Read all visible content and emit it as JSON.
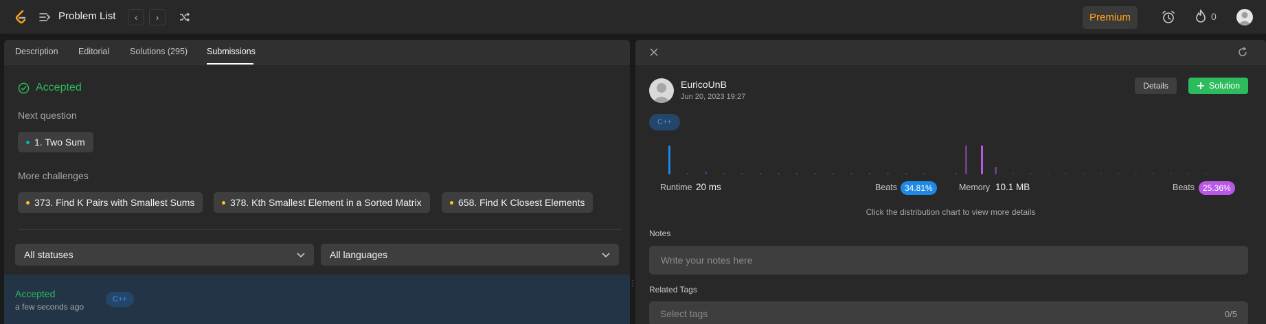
{
  "header": {
    "title": "Problem List",
    "premium_label": "Premium",
    "streak_count": "0"
  },
  "left": {
    "tabs": [
      {
        "label": "Description"
      },
      {
        "label": "Editorial"
      },
      {
        "label": "Solutions (295)"
      },
      {
        "label": "Submissions"
      }
    ],
    "active_tab": "Submissions",
    "status": "Accepted",
    "next_question_label": "Next question",
    "next_question": "1. Two Sum",
    "more_challenges_label": "More challenges",
    "challenges": [
      {
        "label": "373. Find K Pairs with Smallest Sums"
      },
      {
        "label": "378. Kth Smallest Element in a Sorted Matrix"
      },
      {
        "label": "658. Find K Closest Elements"
      }
    ],
    "filter_status": "All statuses",
    "filter_language": "All languages",
    "submission": {
      "status": "Accepted",
      "time": "a few seconds ago",
      "language": "C++"
    }
  },
  "right": {
    "user": "EuricoUnB",
    "date": "Jun 20, 2023 19:27",
    "details_label": "Details",
    "solution_label": "Solution",
    "language": "C++",
    "runtime_label": "Runtime",
    "runtime_value": "20 ms",
    "runtime_beats_label": "Beats",
    "runtime_beats": "34.81%",
    "memory_label": "Memory",
    "memory_value": "10.1 MB",
    "memory_beats_label": "Beats",
    "memory_beats": "25.36%",
    "hint": "Click the distribution chart to view more details",
    "notes_label": "Notes",
    "notes_placeholder": "Write your notes here",
    "tags_label": "Related Tags",
    "tags_placeholder": "Select tags",
    "tags_count": "0/5"
  },
  "colors": {
    "accepted": "#2cbb5d",
    "premium": "#ffa116",
    "runtime": "#1e88e5",
    "memory": "#b958e6",
    "easy_dot": "#00b8a3",
    "medium_dot": "#ffc01e"
  }
}
